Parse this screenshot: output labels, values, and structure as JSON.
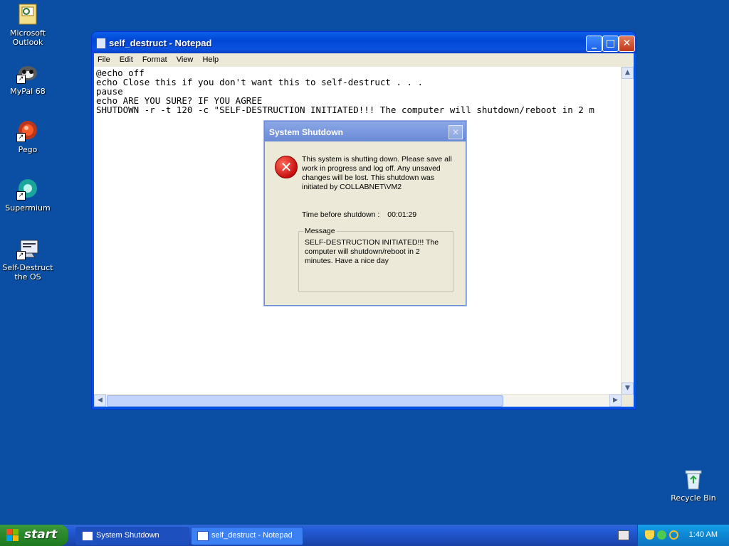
{
  "desktop": {
    "icons": [
      {
        "label": "Microsoft Outlook",
        "icon": "outlook-icon"
      },
      {
        "label": "MyPal 68",
        "icon": "mypal-icon"
      },
      {
        "label": "Pego",
        "icon": "pego-icon"
      },
      {
        "label": "Supermium",
        "icon": "supermium-icon"
      },
      {
        "label": "Self-Destruct the OS",
        "icon": "batch-file-icon"
      },
      {
        "label": "Recycle Bin",
        "icon": "recycle-bin-icon"
      }
    ]
  },
  "notepad": {
    "title": "self_destruct - Notepad",
    "menu": [
      "File",
      "Edit",
      "Format",
      "View",
      "Help"
    ],
    "content": "@echo off\necho Close this if you don't want this to self-destruct . . .\npause\necho ARE YOU SURE? IF YOU AGREE\nSHUTDOWN -r -t 120 -c \"SELF-DESTRUCTION INITIATED!!! The computer will shutdown/reboot in 2 m"
  },
  "dialog": {
    "title": "System Shutdown",
    "message": "This system is shutting down. Please save all work in progress and log off. Any unsaved changes will be lost. This shutdown was initiated by COLLABNET\\VM2",
    "time_label": "Time before shutdown :",
    "time_value": "00:01:29",
    "group_label": "Message",
    "group_text": "SELF-DESTRUCTION INITIATED!!! The computer will shutdown/reboot in 2 minutes. Have a nice day"
  },
  "taskbar": {
    "start_label": "start",
    "items": [
      "System Shutdown",
      "self_destruct - Notepad"
    ],
    "clock": "1:40 AM"
  },
  "colors": {
    "desktop": "#0a4fa3",
    "titlebar": "#0054e3",
    "start": "#2c8a2c",
    "error": "#c60f0f"
  }
}
